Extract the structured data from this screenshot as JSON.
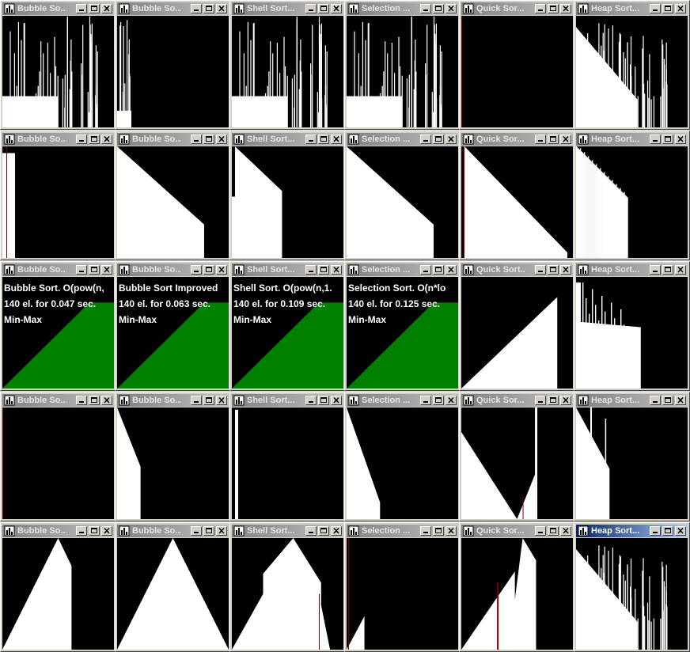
{
  "windows": [
    {
      "title": "Bubble So...",
      "pattern": "random"
    },
    {
      "title": "Bubble So...",
      "pattern": "random-sparse"
    },
    {
      "title": "Shell Sort...",
      "pattern": "random"
    },
    {
      "title": "Selection ...",
      "pattern": "random"
    },
    {
      "title": "Quick Sor...",
      "pattern": "empty"
    },
    {
      "title": "Heap Sort...",
      "pattern": "heap-random"
    },
    {
      "title": "Bubble So...",
      "pattern": "sliver"
    },
    {
      "title": "Bubble So...",
      "pattern": "desc-cut"
    },
    {
      "title": "Shell Sort...",
      "pattern": "desc-cut-small"
    },
    {
      "title": "Selection ...",
      "pattern": "desc-cut"
    },
    {
      "title": "Quick Sor...",
      "pattern": "desc-full"
    },
    {
      "title": "Heap Sort...",
      "pattern": "heap-desc"
    },
    {
      "title": "Bubble So...",
      "pattern": "green",
      "info": [
        "Bubble Sort. O(pow(n,",
        "140 el. for 0.047 sec.",
        "Min-Max"
      ]
    },
    {
      "title": "Bubble So...",
      "pattern": "green",
      "info": [
        "Bubble Sort Improved",
        "140 el. for 0.063 sec.",
        "Min-Max"
      ]
    },
    {
      "title": "Shell Sort...",
      "pattern": "green",
      "info": [
        "Shell Sort. O(pow(n,1.",
        "140 el. for 0.109 sec.",
        "Min-Max"
      ]
    },
    {
      "title": "Selection ...",
      "pattern": "green",
      "info": [
        "Selection Sort. O(n*lo",
        "140 el. for 0.125 sec.",
        "Min-Max"
      ]
    },
    {
      "title": "Quick Sort...",
      "pattern": "asc-white"
    },
    {
      "title": "Heap Sort...",
      "pattern": "heap-asc"
    },
    {
      "title": "Bubble So...",
      "pattern": "empty"
    },
    {
      "title": "Bubble So...",
      "pattern": "wedge"
    },
    {
      "title": "Shell Sort...",
      "pattern": "thin"
    },
    {
      "title": "Selection ...",
      "pattern": "wedge-long"
    },
    {
      "title": "Quick Sor...",
      "pattern": "quick-v"
    },
    {
      "title": "Heap Sort...",
      "pattern": "heap-wedge"
    },
    {
      "title": "Bubble So...",
      "pattern": "mountain-cut"
    },
    {
      "title": "Bubble So...",
      "pattern": "mountain"
    },
    {
      "title": "Shell Sort...",
      "pattern": "mountain-broken"
    },
    {
      "title": "Selection ...",
      "pattern": "small-peak"
    },
    {
      "title": "Quick Sor...",
      "pattern": "mountain-quick"
    },
    {
      "title": "Heap Sort...",
      "pattern": "heap-random",
      "active": true
    }
  ],
  "colors": {
    "bar": "#ffffff",
    "canvas": "#000000",
    "sorted_fill": "#007f00",
    "title_inactive": "#808080",
    "title_active": "#0a246a"
  },
  "icons": {
    "app": "app-icon",
    "minimize": "minimize-icon",
    "maximize": "maximize-icon",
    "close": "close-icon"
  }
}
